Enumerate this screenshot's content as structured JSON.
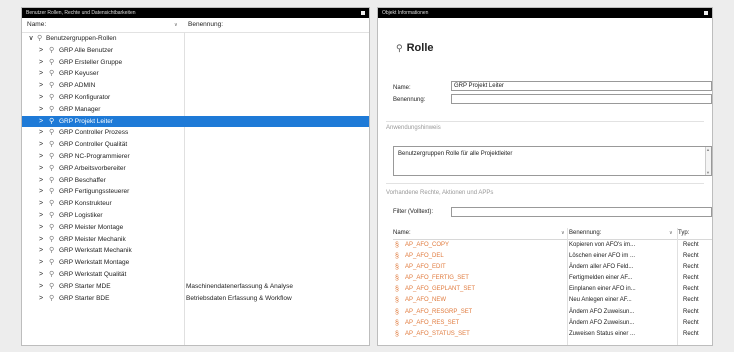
{
  "left_panel": {
    "title": "Benutzer Rollen, Rechte und Datensichtbarkeiten",
    "col_name": "Name:",
    "col_benennung": "Benennung:",
    "root": {
      "label": "Benutzergruppen-Rollen"
    },
    "items": [
      {
        "label": "GRP Alle Benutzer",
        "desc": ""
      },
      {
        "label": "GRP Ersteller Gruppe",
        "desc": ""
      },
      {
        "label": "GRP Keyuser",
        "desc": ""
      },
      {
        "label": "GRP ADMIN",
        "desc": ""
      },
      {
        "label": "GRP Konfigurator",
        "desc": ""
      },
      {
        "label": "GRP Manager",
        "desc": ""
      },
      {
        "label": "GRP Projekt Leiter",
        "desc": "",
        "selected": true
      },
      {
        "label": "GRP Controller Prozess",
        "desc": ""
      },
      {
        "label": "GRP Controller Qualität",
        "desc": ""
      },
      {
        "label": "GRP NC-Programmierer",
        "desc": ""
      },
      {
        "label": "GRP Arbeitsvorbereiter",
        "desc": ""
      },
      {
        "label": "GRP Beschaffer",
        "desc": ""
      },
      {
        "label": "GRP Fertigungssteuerer",
        "desc": ""
      },
      {
        "label": "GRP Konstrukteur",
        "desc": ""
      },
      {
        "label": "GRP Logistiker",
        "desc": ""
      },
      {
        "label": "GRP Meister Montage",
        "desc": ""
      },
      {
        "label": "GRP Meister Mechanik",
        "desc": ""
      },
      {
        "label": "GRP Werkstatt Mechanik",
        "desc": ""
      },
      {
        "label": "GRP Werkstatt Montage",
        "desc": ""
      },
      {
        "label": "GRP Werkstatt Qualität",
        "desc": ""
      },
      {
        "label": "GRP Starter MDE",
        "desc": "Maschinendatenerfassung & Analyse"
      },
      {
        "label": "GRP Starter BDE",
        "desc": "Betriebsdaten Erfassung & Workflow"
      }
    ]
  },
  "right_panel": {
    "title": "Objekt Informationen",
    "heading": "Rolle",
    "name_label": "Name:",
    "name_value": "GRP Projekt Leiter",
    "benennung_label": "Benennung:",
    "benennung_value": "",
    "anwendungshinweis_label": "Anwendungshinweis",
    "anwendungshinweis_value": "Benutzergruppen Rolle für alle Projektleiter",
    "rights_label": "Vorhandene Rechte, Aktionen und APPs",
    "filter_label": "Filter (Volltext):",
    "filter_value": "",
    "col_name": "Name:",
    "col_benennung": "Benennung:",
    "col_typ": "Typ:",
    "rights": [
      {
        "name": "AP_AFO_COPY",
        "desc": "Kopieren von AFO's im...",
        "typ": "Recht"
      },
      {
        "name": "AP_AFO_DEL",
        "desc": "Löschen einer AFO im ...",
        "typ": "Recht"
      },
      {
        "name": "AP_AFO_EDIT",
        "desc": "Ändern aller AFO Feld...",
        "typ": "Recht"
      },
      {
        "name": "AP_AFO_FERTIG_SET",
        "desc": "Fertigmelden einer AF...",
        "typ": "Recht"
      },
      {
        "name": "AP_AFO_GEPLANT_SET",
        "desc": "Einplanen einer AFO in...",
        "typ": "Recht"
      },
      {
        "name": "AP_AFO_NEW",
        "desc": "Neu Anlegen einer AF...",
        "typ": "Recht"
      },
      {
        "name": "AP_AFO_RESGRP_SET",
        "desc": "Ändern AFO Zuweisun...",
        "typ": "Recht"
      },
      {
        "name": "AP_AFO_RES_SET",
        "desc": "Ändern AFO Zuweisun...",
        "typ": "Recht"
      },
      {
        "name": "AP_AFO_STATUS_SET",
        "desc": "Zuweisen Status einer ...",
        "typ": "Recht"
      }
    ]
  }
}
